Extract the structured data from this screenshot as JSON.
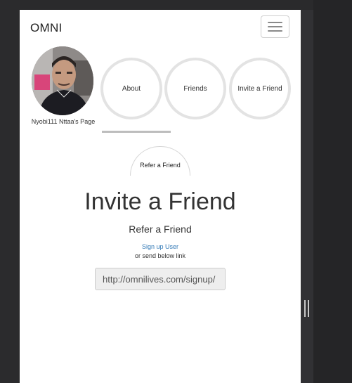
{
  "navbar": {
    "brand": "OMNI",
    "menu_icon": "hamburger-menu-icon"
  },
  "profile": {
    "name": "Nyobi111 Nttaa's Page"
  },
  "nav_circles": [
    {
      "label": "About"
    },
    {
      "label": "Friends"
    },
    {
      "label": "Invite a Friend"
    }
  ],
  "refer_tab": {
    "label": "Refer a Friend"
  },
  "main": {
    "heading": "Invite a Friend",
    "subheading": "Refer a Friend",
    "signup_link": "Sign up User",
    "or_text": "or send below link",
    "link_value": "http://omnilives.com/signup/"
  },
  "colors": {
    "link": "#337ab7",
    "field_bg": "#eeeeee",
    "circle_border": "#e3e3e3"
  }
}
